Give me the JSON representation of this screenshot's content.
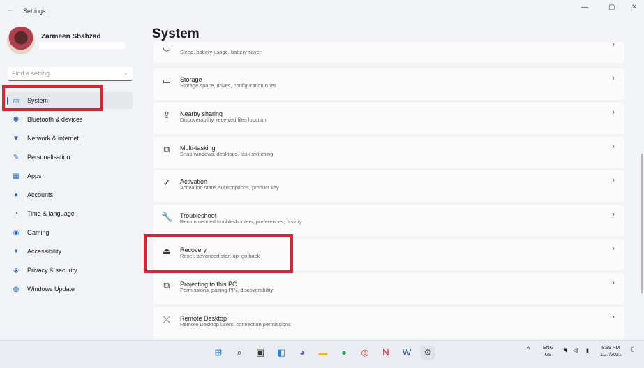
{
  "window": {
    "title": "Settings",
    "back": "←",
    "min": "—",
    "max": "▢",
    "close": "✕"
  },
  "user": {
    "name": "Zarmeen Shahzad"
  },
  "search": {
    "placeholder": "Find a setting",
    "icon": "search-icon"
  },
  "sidebar": {
    "items": [
      {
        "label": "System",
        "icon": "▭",
        "active": true
      },
      {
        "label": "Bluetooth & devices",
        "icon": "✱"
      },
      {
        "label": "Network & internet",
        "icon": "▼"
      },
      {
        "label": "Personalisation",
        "icon": "✎"
      },
      {
        "label": "Apps",
        "icon": "▦"
      },
      {
        "label": "Accounts",
        "icon": "●"
      },
      {
        "label": "Time & language",
        "icon": "◔"
      },
      {
        "label": "Gaming",
        "icon": "◉"
      },
      {
        "label": "Accessibility",
        "icon": "✦"
      },
      {
        "label": "Privacy & security",
        "icon": "◈"
      },
      {
        "label": "Windows Update",
        "icon": "◍"
      }
    ]
  },
  "main": {
    "title": "System",
    "items": [
      {
        "title": "",
        "subtitle": "Sleep, battery usage, battery saver",
        "icon": "◡"
      },
      {
        "title": "Storage",
        "subtitle": "Storage space, drives, configuration rules",
        "icon": "▭"
      },
      {
        "title": "Nearby sharing",
        "subtitle": "Discoverability, received files location",
        "icon": "⇪"
      },
      {
        "title": "Multi-tasking",
        "subtitle": "Snap windows, desktops, task switching",
        "icon": "⧉"
      },
      {
        "title": "Activation",
        "subtitle": "Activation state, subscriptions, product key",
        "icon": "✓"
      },
      {
        "title": "Troubleshoot",
        "subtitle": "Recommended troubleshooters, preferences, history",
        "icon": "🔧"
      },
      {
        "title": "Recovery",
        "subtitle": "Reset, advanced start-up, go back",
        "icon": "⏏"
      },
      {
        "title": "Projecting to this PC",
        "subtitle": "Permissions, pairing PIN, discoverability",
        "icon": "⧉"
      },
      {
        "title": "Remote Desktop",
        "subtitle": "Remote Desktop users, connection permissions",
        "icon": "⤫"
      }
    ],
    "chevron": "›"
  },
  "taskbar": {
    "apps": [
      {
        "name": "start",
        "icon": "⊞",
        "color": "#1a73d9"
      },
      {
        "name": "search",
        "icon": "⌕",
        "color": "#222"
      },
      {
        "name": "task-view",
        "icon": "▣",
        "color": "#333"
      },
      {
        "name": "widgets",
        "icon": "◧",
        "color": "#2a7ad8"
      },
      {
        "name": "chat",
        "icon": "◕",
        "color": "#6b5bd6"
      },
      {
        "name": "file-explorer",
        "icon": "▬",
        "color": "#e8b92c"
      },
      {
        "name": "spotify",
        "icon": "●",
        "color": "#1db954"
      },
      {
        "name": "chrome",
        "icon": "◎",
        "color": "#db4437"
      },
      {
        "name": "netflix",
        "icon": "N",
        "color": "#e50914"
      },
      {
        "name": "word",
        "icon": "W",
        "color": "#2b579a"
      },
      {
        "name": "settings",
        "icon": "⚙",
        "color": "#555"
      }
    ],
    "tray": {
      "chevron": "^",
      "lang1": "ENG",
      "lang2": "US",
      "wifi": "◥",
      "volume": "◁)",
      "battery": "▮",
      "time": "8:39 PM",
      "date": "11/7/2021",
      "notif": "☾"
    }
  }
}
